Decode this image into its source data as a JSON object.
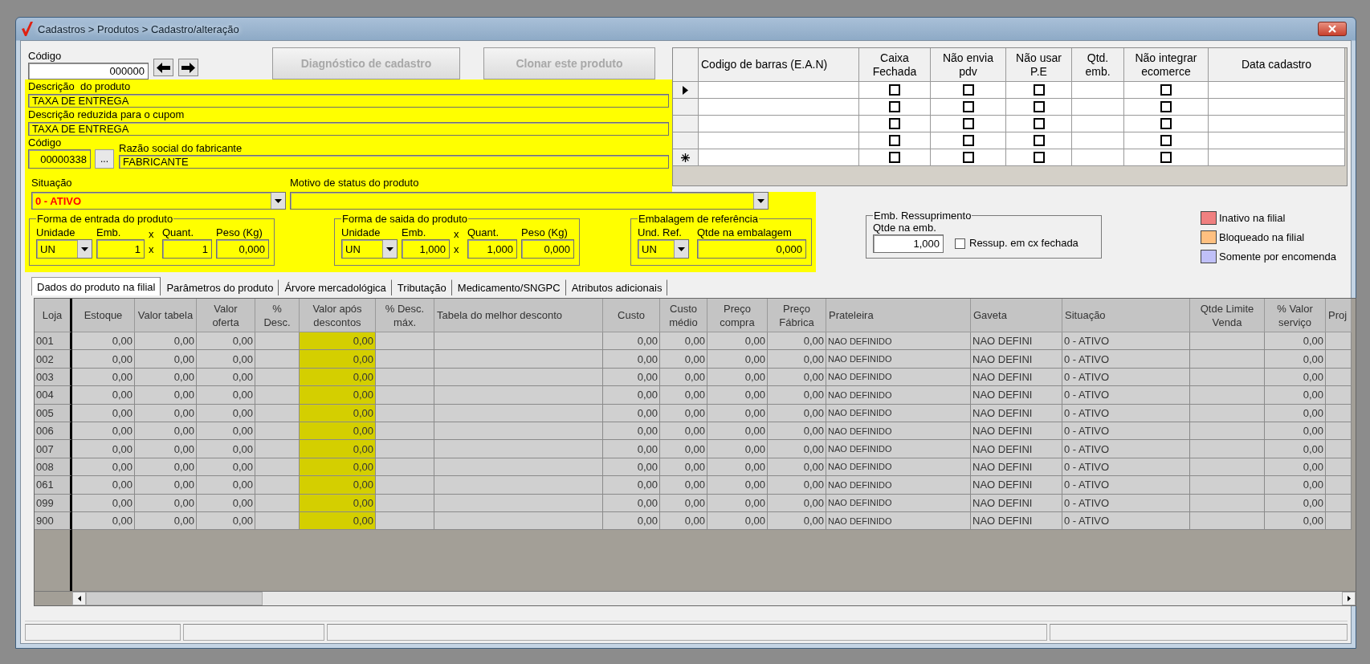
{
  "window": {
    "title": "Cadastros > Produtos > Cadastro/alteração"
  },
  "header": {
    "code_label": "Código",
    "code": "000000",
    "buttons": [
      {
        "label": "Diagnóstico de cadastro",
        "disabled": true
      },
      {
        "label": "Clonar este produto",
        "disabled": true
      }
    ]
  },
  "fields": {
    "description": {
      "label": "Descrição  do produto",
      "value": "TAXA DE ENTREGA"
    },
    "short_description": {
      "label": "Descrição reduzida para o cupom",
      "value": "TAXA DE ENTREGA"
    },
    "manufacturer_code": {
      "label": "Código",
      "value": "00000338"
    },
    "manufacturer_lookup": "...",
    "manufacturer_name": {
      "label": "Razão social do fabricante",
      "value": "FABRICANTE"
    },
    "status": {
      "label": "Situação",
      "value": "0 - ATIVO"
    },
    "status_reason": {
      "label": "Motivo de status do produto"
    }
  },
  "entry_form": {
    "title": "Forma de entrada do produto",
    "unit_label": "Unidade",
    "unit": "UN",
    "pack_label": "Emb.",
    "times_label": "x",
    "qty_label": "Quant.",
    "weight_label": "Peso (Kg)",
    "pack": "1",
    "times": "x",
    "qty": "1",
    "weight": "0,000"
  },
  "exit_form": {
    "title": "Forma de saida do produto",
    "unit_label": "Unidade",
    "unit": "UN",
    "pack_label": "Emb.",
    "times_label": "x",
    "qty_label": "Quant.",
    "weight_label": "Peso (Kg)",
    "pack": "1,000",
    "times": "x",
    "qty": "1,000",
    "weight": "0,000"
  },
  "reference_pack": {
    "title": "Embalagem de referência",
    "unit_label": "Und. Ref.",
    "unit": "UN",
    "qty_label": "Qtde na embalagem",
    "qty": "0,000"
  },
  "restock": {
    "title": "Emb. Ressuprimento",
    "qty_label": "Qtde na emb.",
    "qty": "1,000",
    "closed_box": {
      "label": "Ressup. em cx fechada",
      "checked": false
    }
  },
  "legend": [
    {
      "label": "Inativo na filial",
      "color": "#f08080"
    },
    {
      "label": "Bloqueado na filial",
      "color": "#ffc080"
    },
    {
      "label": "Somente por encomenda",
      "color": "#c0c0f8"
    }
  ],
  "barcodes": {
    "columns": [
      "Codigo de barras (E.A.N)",
      "Caixa Fechada",
      "Não envia pdv",
      "Não usar P.E",
      "Qtd. emb.",
      "Não integrar ecomerce",
      "Data cadastro"
    ],
    "rows": [
      {
        "kind": "current",
        "checks": [
          false,
          false,
          false,
          false
        ]
      },
      {
        "kind": "plain",
        "checks": [
          false,
          false,
          false,
          false
        ]
      },
      {
        "kind": "plain",
        "checks": [
          false,
          false,
          false,
          false
        ]
      },
      {
        "kind": "plain",
        "checks": [
          false,
          false,
          false,
          false
        ]
      },
      {
        "kind": "new",
        "checks": [
          false,
          false,
          false,
          false
        ]
      }
    ]
  },
  "tabs": [
    {
      "label": "Dados do produto na filial",
      "selected": true
    },
    {
      "label": "Parâmetros do produto",
      "selected": false
    },
    {
      "label": "Árvore mercadológica",
      "selected": false
    },
    {
      "label": "Tributação",
      "selected": false
    },
    {
      "label": "Medicamento/SNGPC",
      "selected": false
    },
    {
      "label": "Atributos adicionais",
      "selected": false
    }
  ],
  "stock_grid": {
    "columns": [
      {
        "label": "Loja",
        "kind": "text",
        "highlighted": false
      },
      {
        "label": "Estoque",
        "kind": "number",
        "highlighted": false
      },
      {
        "label": "Valor tabela",
        "kind": "number",
        "highlighted": false
      },
      {
        "label": "Valor oferta",
        "kind": "number",
        "highlighted": false
      },
      {
        "label": "% Desc.",
        "kind": "number",
        "highlighted": false
      },
      {
        "label": "Valor após descontos",
        "kind": "number",
        "highlighted": true
      },
      {
        "label": "% Desc. máx.",
        "kind": "number",
        "highlighted": false
      },
      {
        "label": "Tabela do melhor desconto",
        "kind": "text",
        "highlighted": false
      },
      {
        "label": "Custo",
        "kind": "number",
        "highlighted": false
      },
      {
        "label": "Custo médio",
        "kind": "number",
        "highlighted": false
      },
      {
        "label": "Preço compra",
        "kind": "number",
        "highlighted": false
      },
      {
        "label": "Preço Fábrica",
        "kind": "number",
        "highlighted": false
      },
      {
        "label": "Prateleira",
        "kind": "small",
        "highlighted": false
      },
      {
        "label": "Gaveta",
        "kind": "text",
        "highlighted": false
      },
      {
        "label": "Situação",
        "kind": "text",
        "highlighted": false
      },
      {
        "label": "Qtde Limite Venda",
        "kind": "number",
        "highlighted": false
      },
      {
        "label": "% Valor serviço",
        "kind": "number",
        "highlighted": false
      },
      {
        "label": "Proj",
        "kind": "text",
        "highlighted": false
      }
    ],
    "rows": [
      [
        "001",
        "0,00",
        "0,00",
        "0,00",
        null,
        "0,00",
        null,
        null,
        "0,00",
        "0,00",
        "0,00",
        "0,00",
        "NAO DEFINIDO",
        "NAO DEFINI",
        "0 - ATIVO",
        null,
        "0,00",
        null
      ],
      [
        "002",
        "0,00",
        "0,00",
        "0,00",
        null,
        "0,00",
        null,
        null,
        "0,00",
        "0,00",
        "0,00",
        "0,00",
        "NAO DEFINIDO",
        "NAO DEFINI",
        "0 - ATIVO",
        null,
        "0,00",
        null
      ],
      [
        "003",
        "0,00",
        "0,00",
        "0,00",
        null,
        "0,00",
        null,
        null,
        "0,00",
        "0,00",
        "0,00",
        "0,00",
        "NAO DEFINIDO",
        "NAO DEFINI",
        "0 - ATIVO",
        null,
        "0,00",
        null
      ],
      [
        "004",
        "0,00",
        "0,00",
        "0,00",
        null,
        "0,00",
        null,
        null,
        "0,00",
        "0,00",
        "0,00",
        "0,00",
        "NAO DEFINIDO",
        "NAO DEFINI",
        "0 - ATIVO",
        null,
        "0,00",
        null
      ],
      [
        "005",
        "0,00",
        "0,00",
        "0,00",
        null,
        "0,00",
        null,
        null,
        "0,00",
        "0,00",
        "0,00",
        "0,00",
        "NAO DEFINIDO",
        "NAO DEFINI",
        "0 - ATIVO",
        null,
        "0,00",
        null
      ],
      [
        "006",
        "0,00",
        "0,00",
        "0,00",
        null,
        "0,00",
        null,
        null,
        "0,00",
        "0,00",
        "0,00",
        "0,00",
        "NAO DEFINIDO",
        "NAO DEFINI",
        "0 - ATIVO",
        null,
        "0,00",
        null
      ],
      [
        "007",
        "0,00",
        "0,00",
        "0,00",
        null,
        "0,00",
        null,
        null,
        "0,00",
        "0,00",
        "0,00",
        "0,00",
        "NAO DEFINIDO",
        "NAO DEFINI",
        "0 - ATIVO",
        null,
        "0,00",
        null
      ],
      [
        "008",
        "0,00",
        "0,00",
        "0,00",
        null,
        "0,00",
        null,
        null,
        "0,00",
        "0,00",
        "0,00",
        "0,00",
        "NAO DEFINIDO",
        "NAO DEFINI",
        "0 - ATIVO",
        null,
        "0,00",
        null
      ],
      [
        "061",
        "0,00",
        "0,00",
        "0,00",
        null,
        "0,00",
        null,
        null,
        "0,00",
        "0,00",
        "0,00",
        "0,00",
        "NAO DEFINIDO",
        "NAO DEFINI",
        "0 - ATIVO",
        null,
        "0,00",
        null
      ],
      [
        "099",
        "0,00",
        "0,00",
        "0,00",
        null,
        "0,00",
        null,
        null,
        "0,00",
        "0,00",
        "0,00",
        "0,00",
        "NAO DEFINIDO",
        "NAO DEFINI",
        "0 - ATIVO",
        null,
        "0,00",
        null
      ],
      [
        "900",
        "0,00",
        "0,00",
        "0,00",
        null,
        "0,00",
        null,
        null,
        "0,00",
        "0,00",
        "0,00",
        "0,00",
        "NAO DEFINIDO",
        "NAO DEFINI",
        "0 - ATIVO",
        null,
        "0,00",
        null
      ]
    ]
  }
}
